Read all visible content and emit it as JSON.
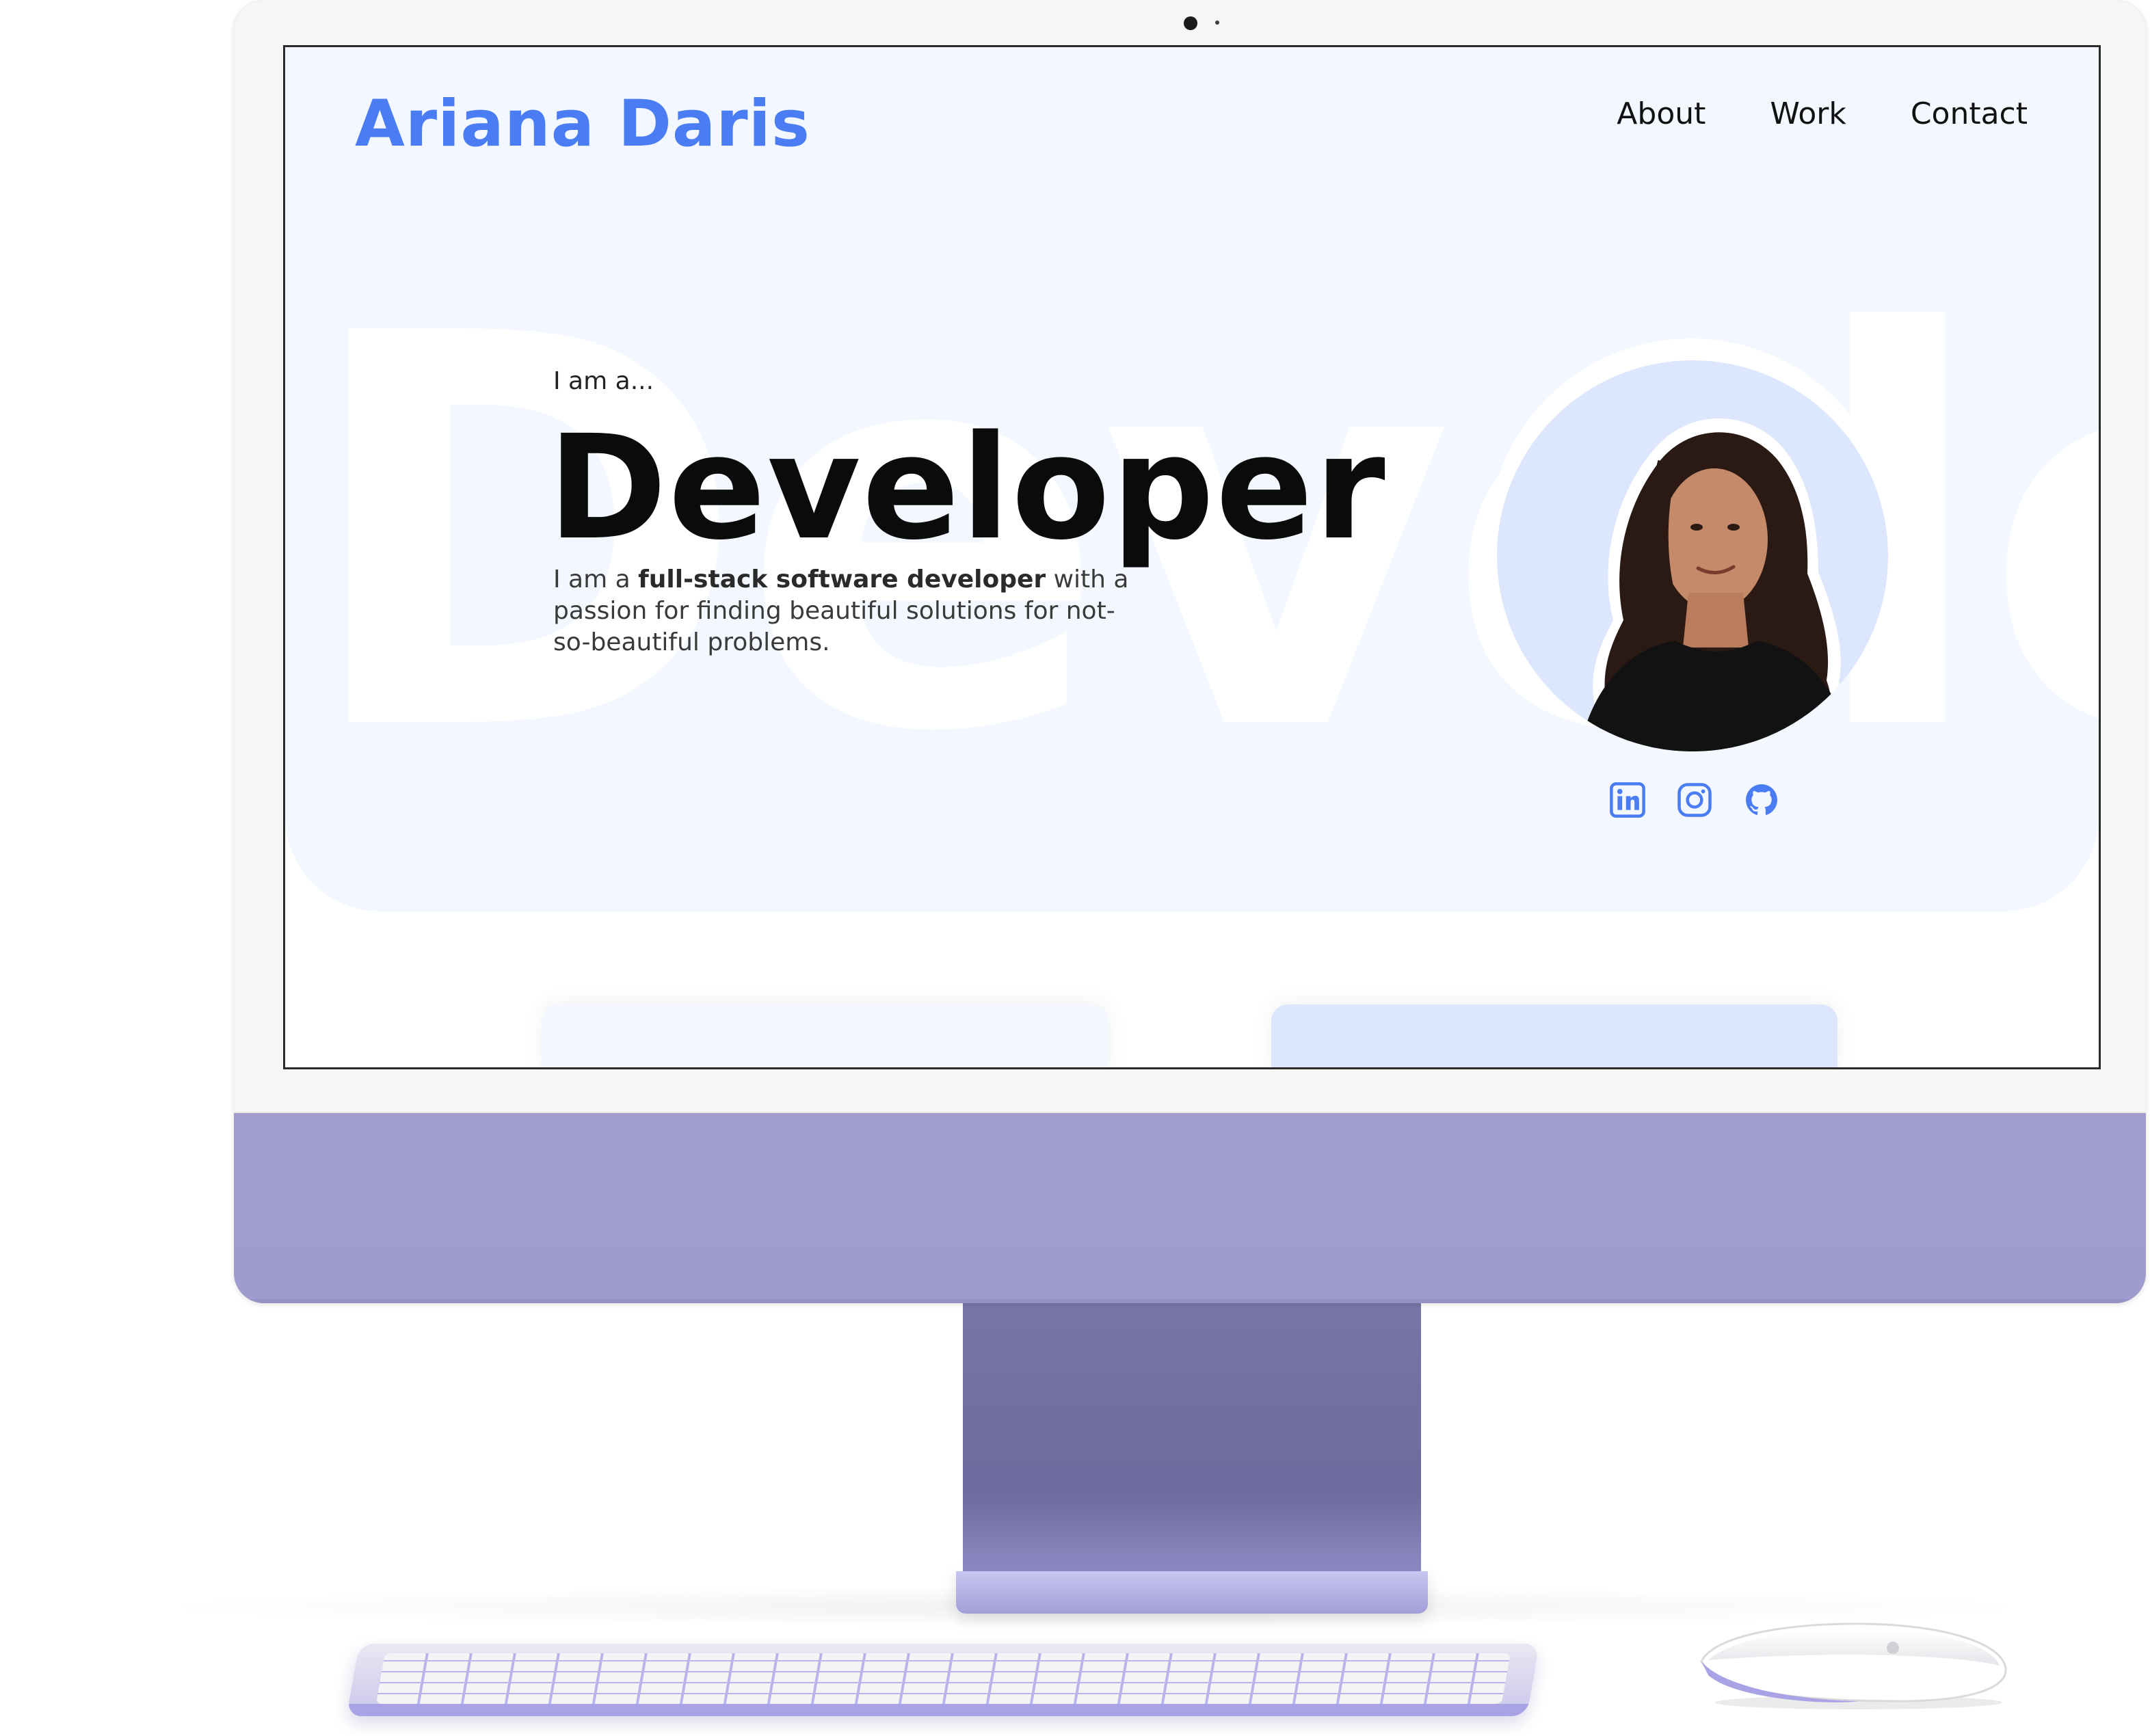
{
  "site": {
    "brand": "Ariana Daris",
    "nav": [
      {
        "label": "About"
      },
      {
        "label": "Work"
      },
      {
        "label": "Contact"
      }
    ],
    "hero": {
      "watermark": "Develop",
      "intro": "I am a...",
      "role": "Developer",
      "bio_prefix": "I am a ",
      "bio_bold": "full-stack software developer",
      "bio_suffix": " with a passion for finding beautiful solutions for not-so-beautiful problems."
    },
    "socials": [
      {
        "icon": "linkedin-icon"
      },
      {
        "icon": "instagram-icon"
      },
      {
        "icon": "github-icon"
      }
    ]
  },
  "colors": {
    "brand_blue": "#4a7cf4",
    "hero_bg": "#f3f7ff",
    "avatar_bg": "#dce6fd",
    "imac_purple": "#a7a4d4"
  }
}
